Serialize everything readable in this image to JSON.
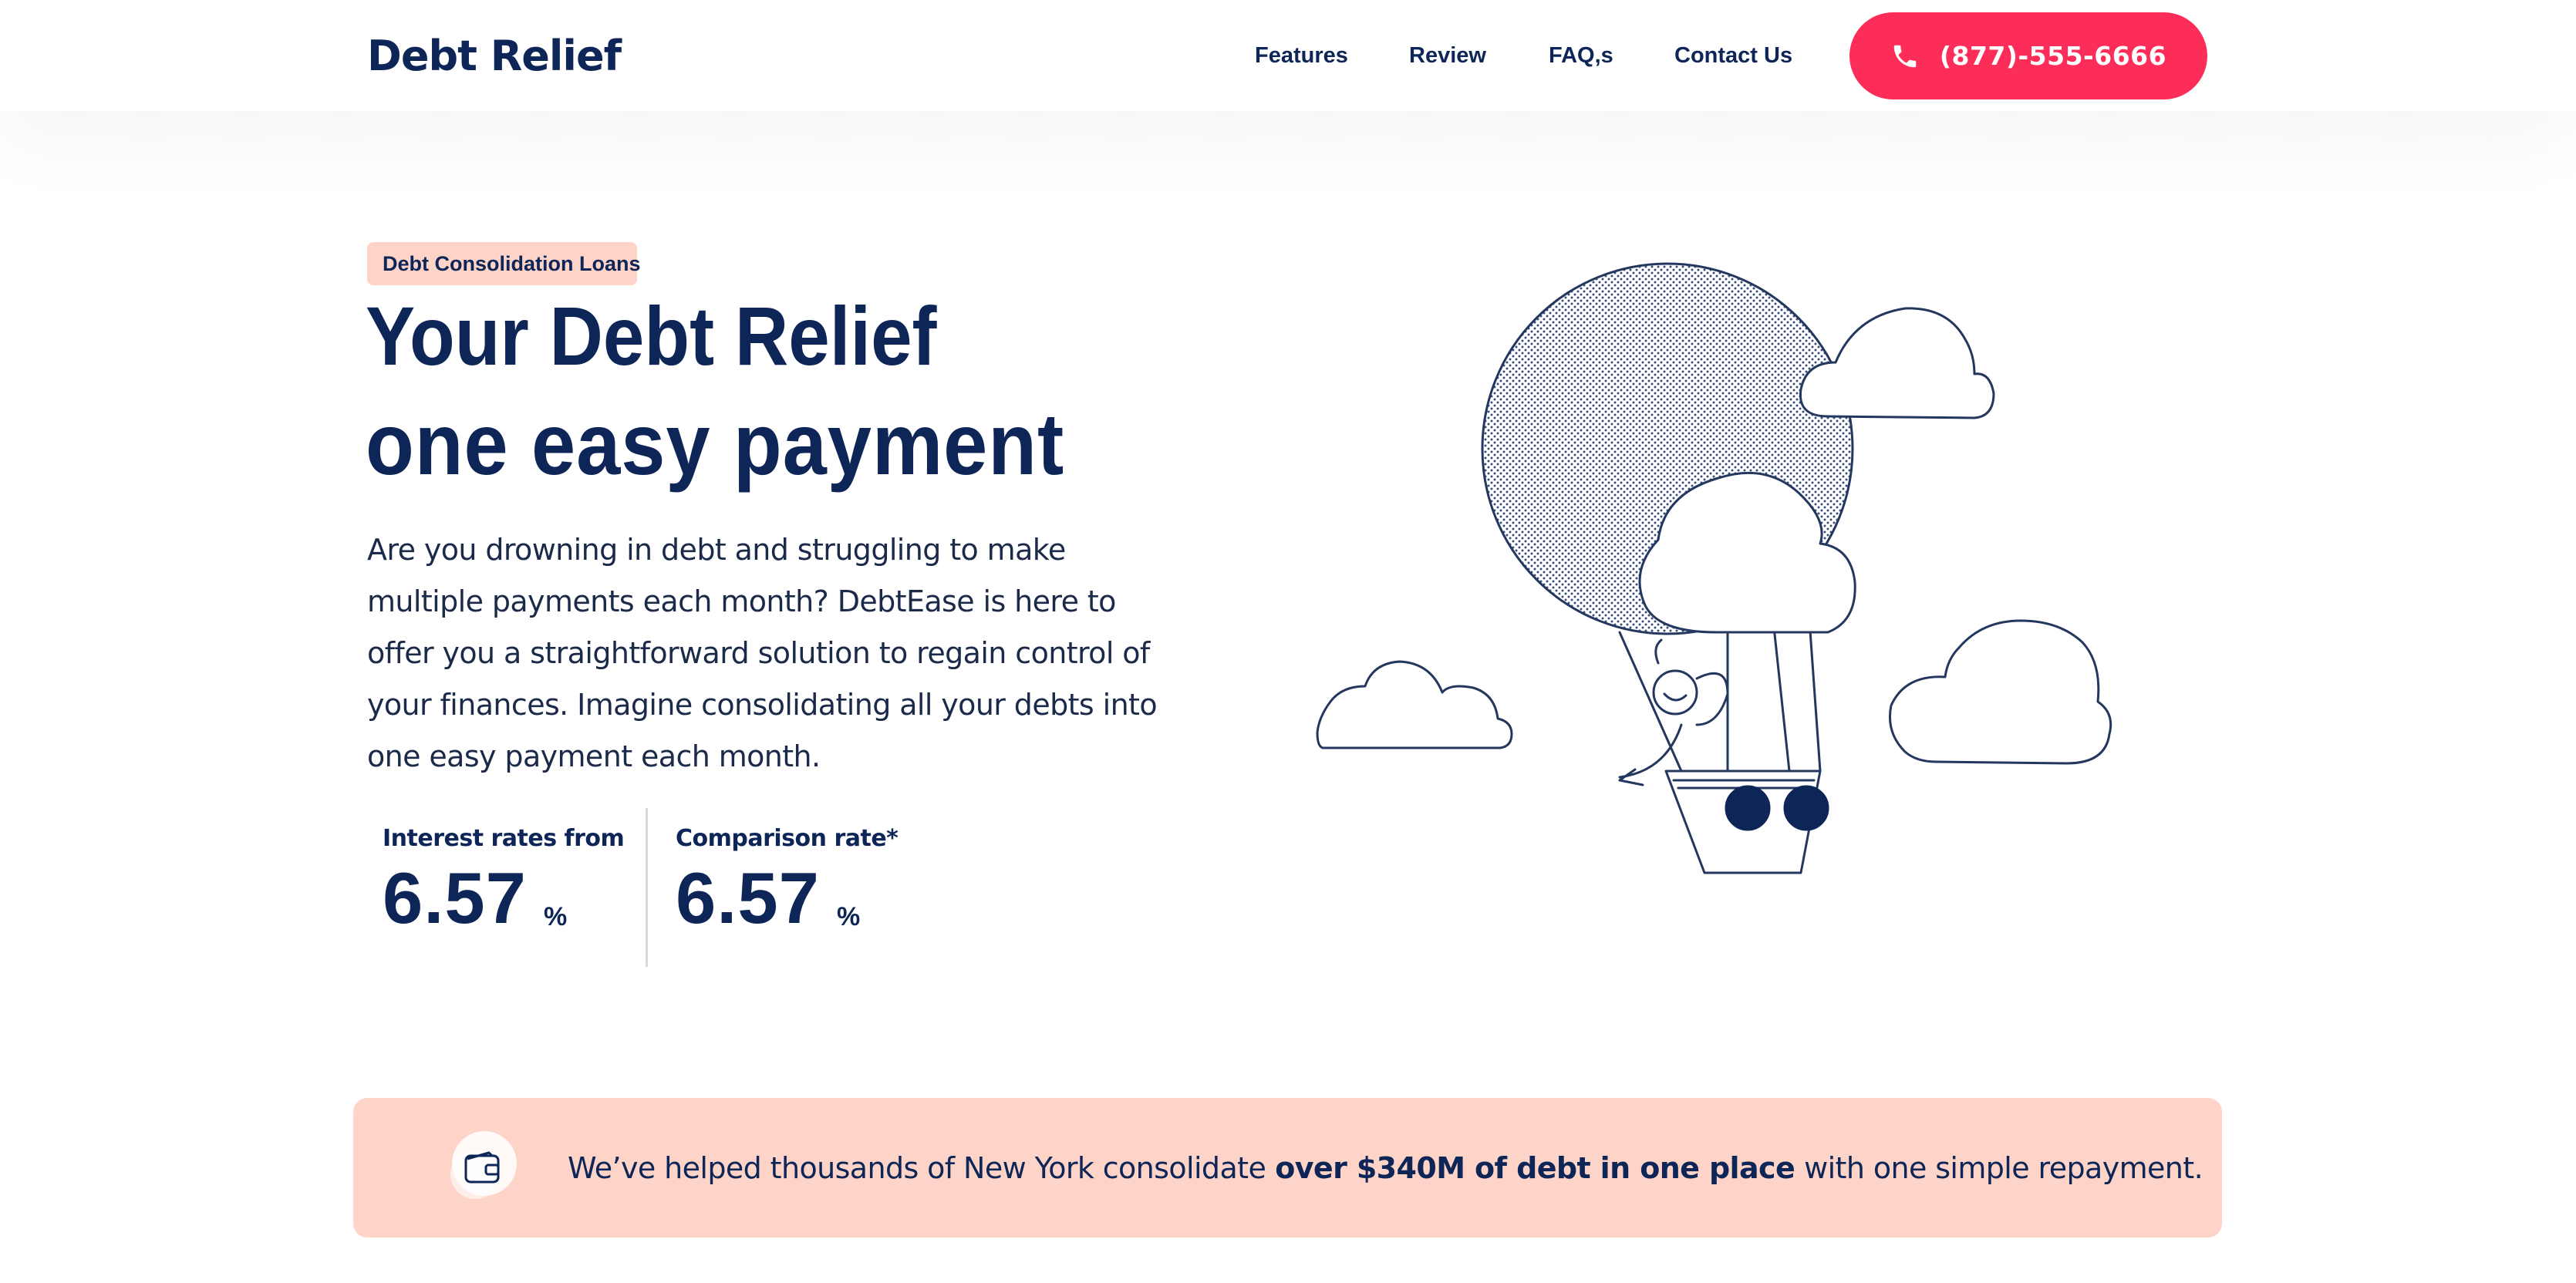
{
  "header": {
    "logo": "Debt Relief",
    "nav": {
      "features": "Features",
      "review": "Review",
      "faq": "FAQ,s",
      "contact": "Contact Us"
    },
    "phone_button": {
      "label": "(877)-555-6666",
      "icon": "phone-icon"
    }
  },
  "hero": {
    "badge": "Debt Consolidation Loans",
    "title_line1": "Your Debt Relief",
    "title_line2": "one easy payment",
    "description": "Are you drowning in debt and struggling to make multiple payments each month? DebtEase is here to offer you a straightforward solution to regain control of your finances. Imagine consolidating all your debts into one easy payment each month.",
    "stats": [
      {
        "label": "Interest rates from",
        "value": "6.57",
        "unit": "%"
      },
      {
        "label": "Comparison rate*",
        "value": "6.57",
        "unit": "%"
      }
    ],
    "illustration": "hot-air-balloon-with-clouds"
  },
  "banner": {
    "icon": "wallet-icon",
    "text_before": "We’ve helped thousands of New York consolidate",
    "text_bold": "over $340M of debt in one place",
    "text_after": "with one simple repayment."
  },
  "colors": {
    "navy": "#0d2557",
    "accent": "#fc2d58",
    "peach": "#fdd4c7"
  }
}
